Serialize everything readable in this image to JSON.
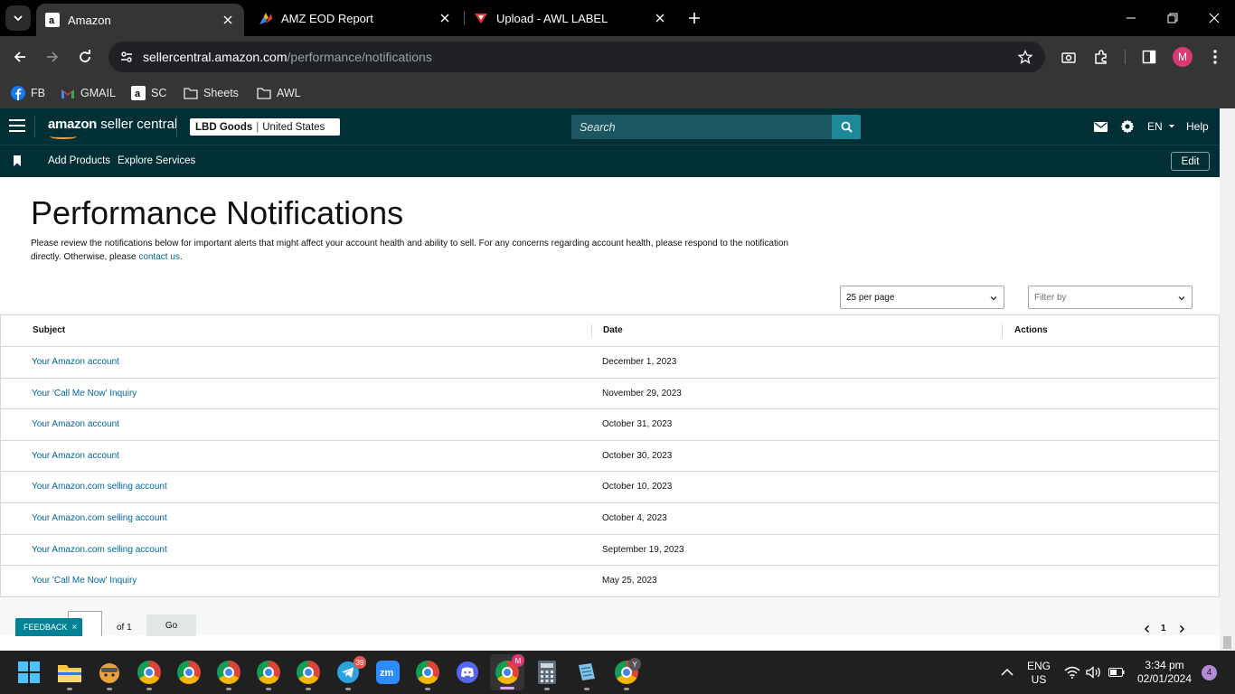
{
  "browser": {
    "tabs": [
      {
        "title": "Amazon",
        "favicon": "amazon-icon"
      },
      {
        "title": "AMZ EOD Report",
        "favicon": "sheets-icon"
      },
      {
        "title": "Upload - AWL LABEL",
        "favicon": "awl-icon"
      }
    ],
    "address": {
      "host": "sellercentral.amazon.com",
      "path": "/performance/notifications"
    },
    "profile_initial": "M",
    "bookmarks": [
      {
        "label": "FB",
        "icon": "facebook-icon"
      },
      {
        "label": "GMAIL",
        "icon": "gmail-icon"
      },
      {
        "label": "SC",
        "icon": "amazon-icon"
      },
      {
        "label": "Sheets",
        "icon": "folder-icon"
      },
      {
        "label": "AWL",
        "icon": "folder-icon"
      }
    ]
  },
  "header": {
    "brand_amazon": "amazon",
    "brand_rest": " seller central",
    "store_name": "LBD Goods",
    "store_region": "United States",
    "search_placeholder": "Search",
    "language": "EN",
    "help": "Help",
    "colors": {
      "header_bg": "#002f36",
      "search_btn": "#1e8896",
      "link": "#00669d"
    }
  },
  "subnav": {
    "links": [
      "Add Products",
      "Explore Services"
    ],
    "edit": "Edit"
  },
  "page": {
    "title": "Performance Notifications",
    "intro_text": "Please review the notifications below for important alerts that might affect your account health and ability to sell. For any concerns regarding account health, please respond to the notification directly. Otherwise, please ",
    "contact_link": "contact us",
    "intro_end": ".",
    "per_page": "25 per page",
    "filter_placeholder": "Filter by",
    "columns": {
      "subject": "Subject",
      "date": "Date",
      "actions": "Actions"
    },
    "rows": [
      {
        "subject": "Your Amazon account",
        "date": "December 1, 2023"
      },
      {
        "subject": "Your 'Call Me Now' Inquiry",
        "date": "November 29, 2023"
      },
      {
        "subject": "Your Amazon account",
        "date": "October 31, 2023"
      },
      {
        "subject": "Your Amazon account",
        "date": "October 30, 2023"
      },
      {
        "subject": "Your Amazon.com selling account",
        "date": "October 10, 2023"
      },
      {
        "subject": "Your Amazon.com selling account",
        "date": "October 4, 2023"
      },
      {
        "subject": "Your Amazon.com selling account",
        "date": "September 19, 2023"
      },
      {
        "subject": "Your 'Call Me Now' Inquiry",
        "date": "May 25, 2023"
      }
    ],
    "pager": {
      "of_text": "of 1",
      "go": "Go",
      "current_page": "1"
    },
    "feedback": "FEEDBACK"
  },
  "taskbar": {
    "telegram_badge": "39",
    "language_top": "ENG",
    "language_bottom": "US",
    "time": "3:34 pm",
    "date": "02/01/2024",
    "notifications": "4",
    "active_profile_badge": "M"
  }
}
